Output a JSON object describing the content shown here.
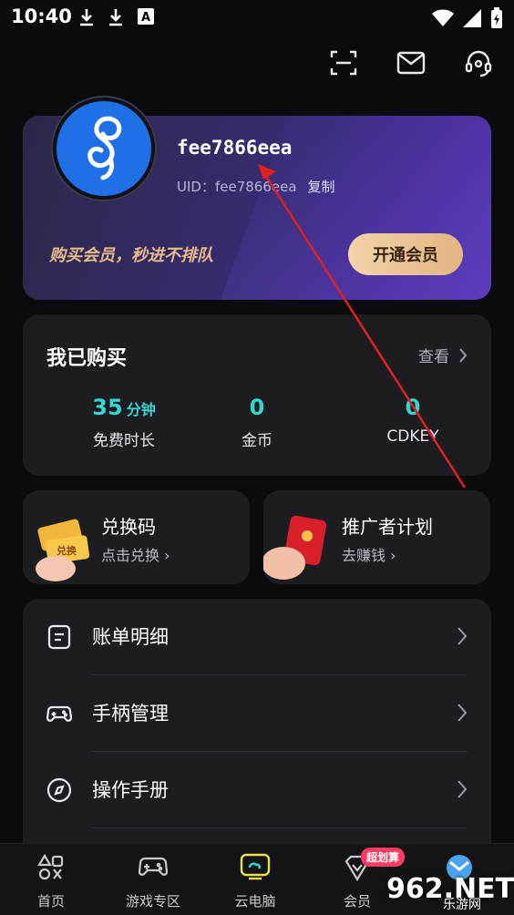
{
  "status_bar": {
    "time": "10:40"
  },
  "colors": {
    "accent_cyan": "#35d6d2",
    "vip_gold": "#e7b98b",
    "annotation_red": "#e02020"
  },
  "profile": {
    "username": "fee7866eea",
    "uid": "UID：fee7866eea",
    "copy_label": "复制",
    "promo_text": "购买会员，秒进不排队",
    "vip_button_label": "开通会员"
  },
  "purchased": {
    "title": "我已购买",
    "view_label": "查看",
    "stats": [
      {
        "value": "35",
        "unit": "分钟",
        "label": "免费时长"
      },
      {
        "value": "0",
        "unit": "",
        "label": "金币"
      },
      {
        "value": "0",
        "unit": "",
        "label": "CDKEY"
      }
    ]
  },
  "cards": [
    {
      "title": "兑换码",
      "subtitle": "点击兑换 ›",
      "icon": "ticket-icon"
    },
    {
      "title": "推广者计划",
      "subtitle": "去赚钱 ›",
      "icon": "red-envelope-icon"
    }
  ],
  "menu": [
    {
      "label": "账单明细",
      "icon": "bill-icon"
    },
    {
      "label": "手柄管理",
      "icon": "gamepad-icon"
    },
    {
      "label": "操作手册",
      "icon": "compass-icon"
    }
  ],
  "tabs": [
    {
      "label": "首页",
      "icon": "home-icon"
    },
    {
      "label": "游戏专区",
      "icon": "gamepad-icon"
    },
    {
      "label": "云电脑",
      "icon": "cloud-pc-icon"
    },
    {
      "label": "会员",
      "icon": "vip-icon"
    },
    {
      "label": "",
      "icon": "profile-icon"
    }
  ],
  "badge": "超划算",
  "watermark": {
    "main": "962.NET",
    "sub": "乐游网"
  }
}
